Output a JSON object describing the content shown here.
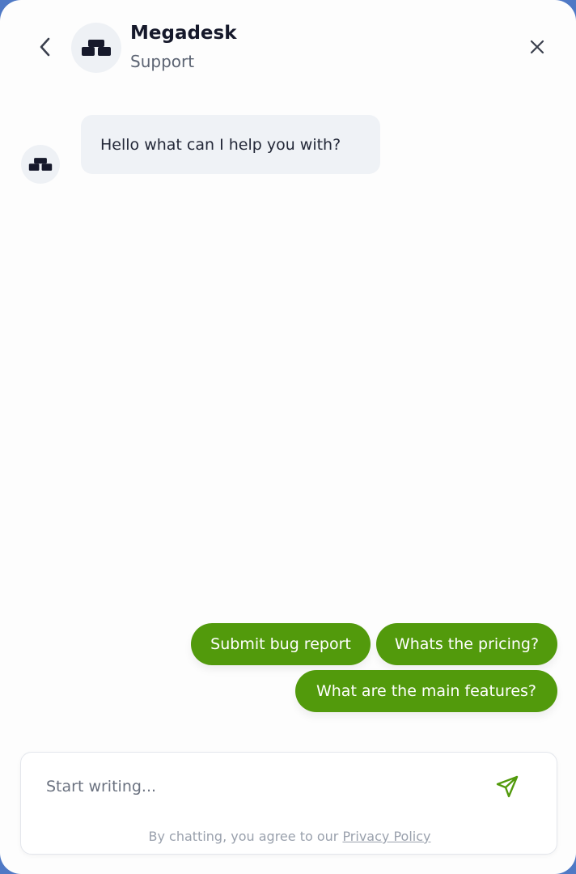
{
  "header": {
    "brand_name": "Megadesk",
    "subtitle": "Support",
    "back_icon": "chevron-left-icon",
    "close_icon": "close-icon",
    "logo_icon": "megadesk-logo-icon"
  },
  "messages": [
    {
      "sender": "bot",
      "text": "Hello what can I help you with?"
    }
  ],
  "quick_replies": [
    "Submit bug report",
    "Whats the pricing?",
    "What are the main features?"
  ],
  "composer": {
    "placeholder": "Start writing...",
    "value": "",
    "send_icon": "send-icon",
    "disclaimer_prefix": "By chatting, you agree to our ",
    "disclaimer_link": "Privacy Policy"
  },
  "colors": {
    "accent": "#529a0c",
    "bubble": "#eff2f6",
    "logo": "#16192b"
  }
}
